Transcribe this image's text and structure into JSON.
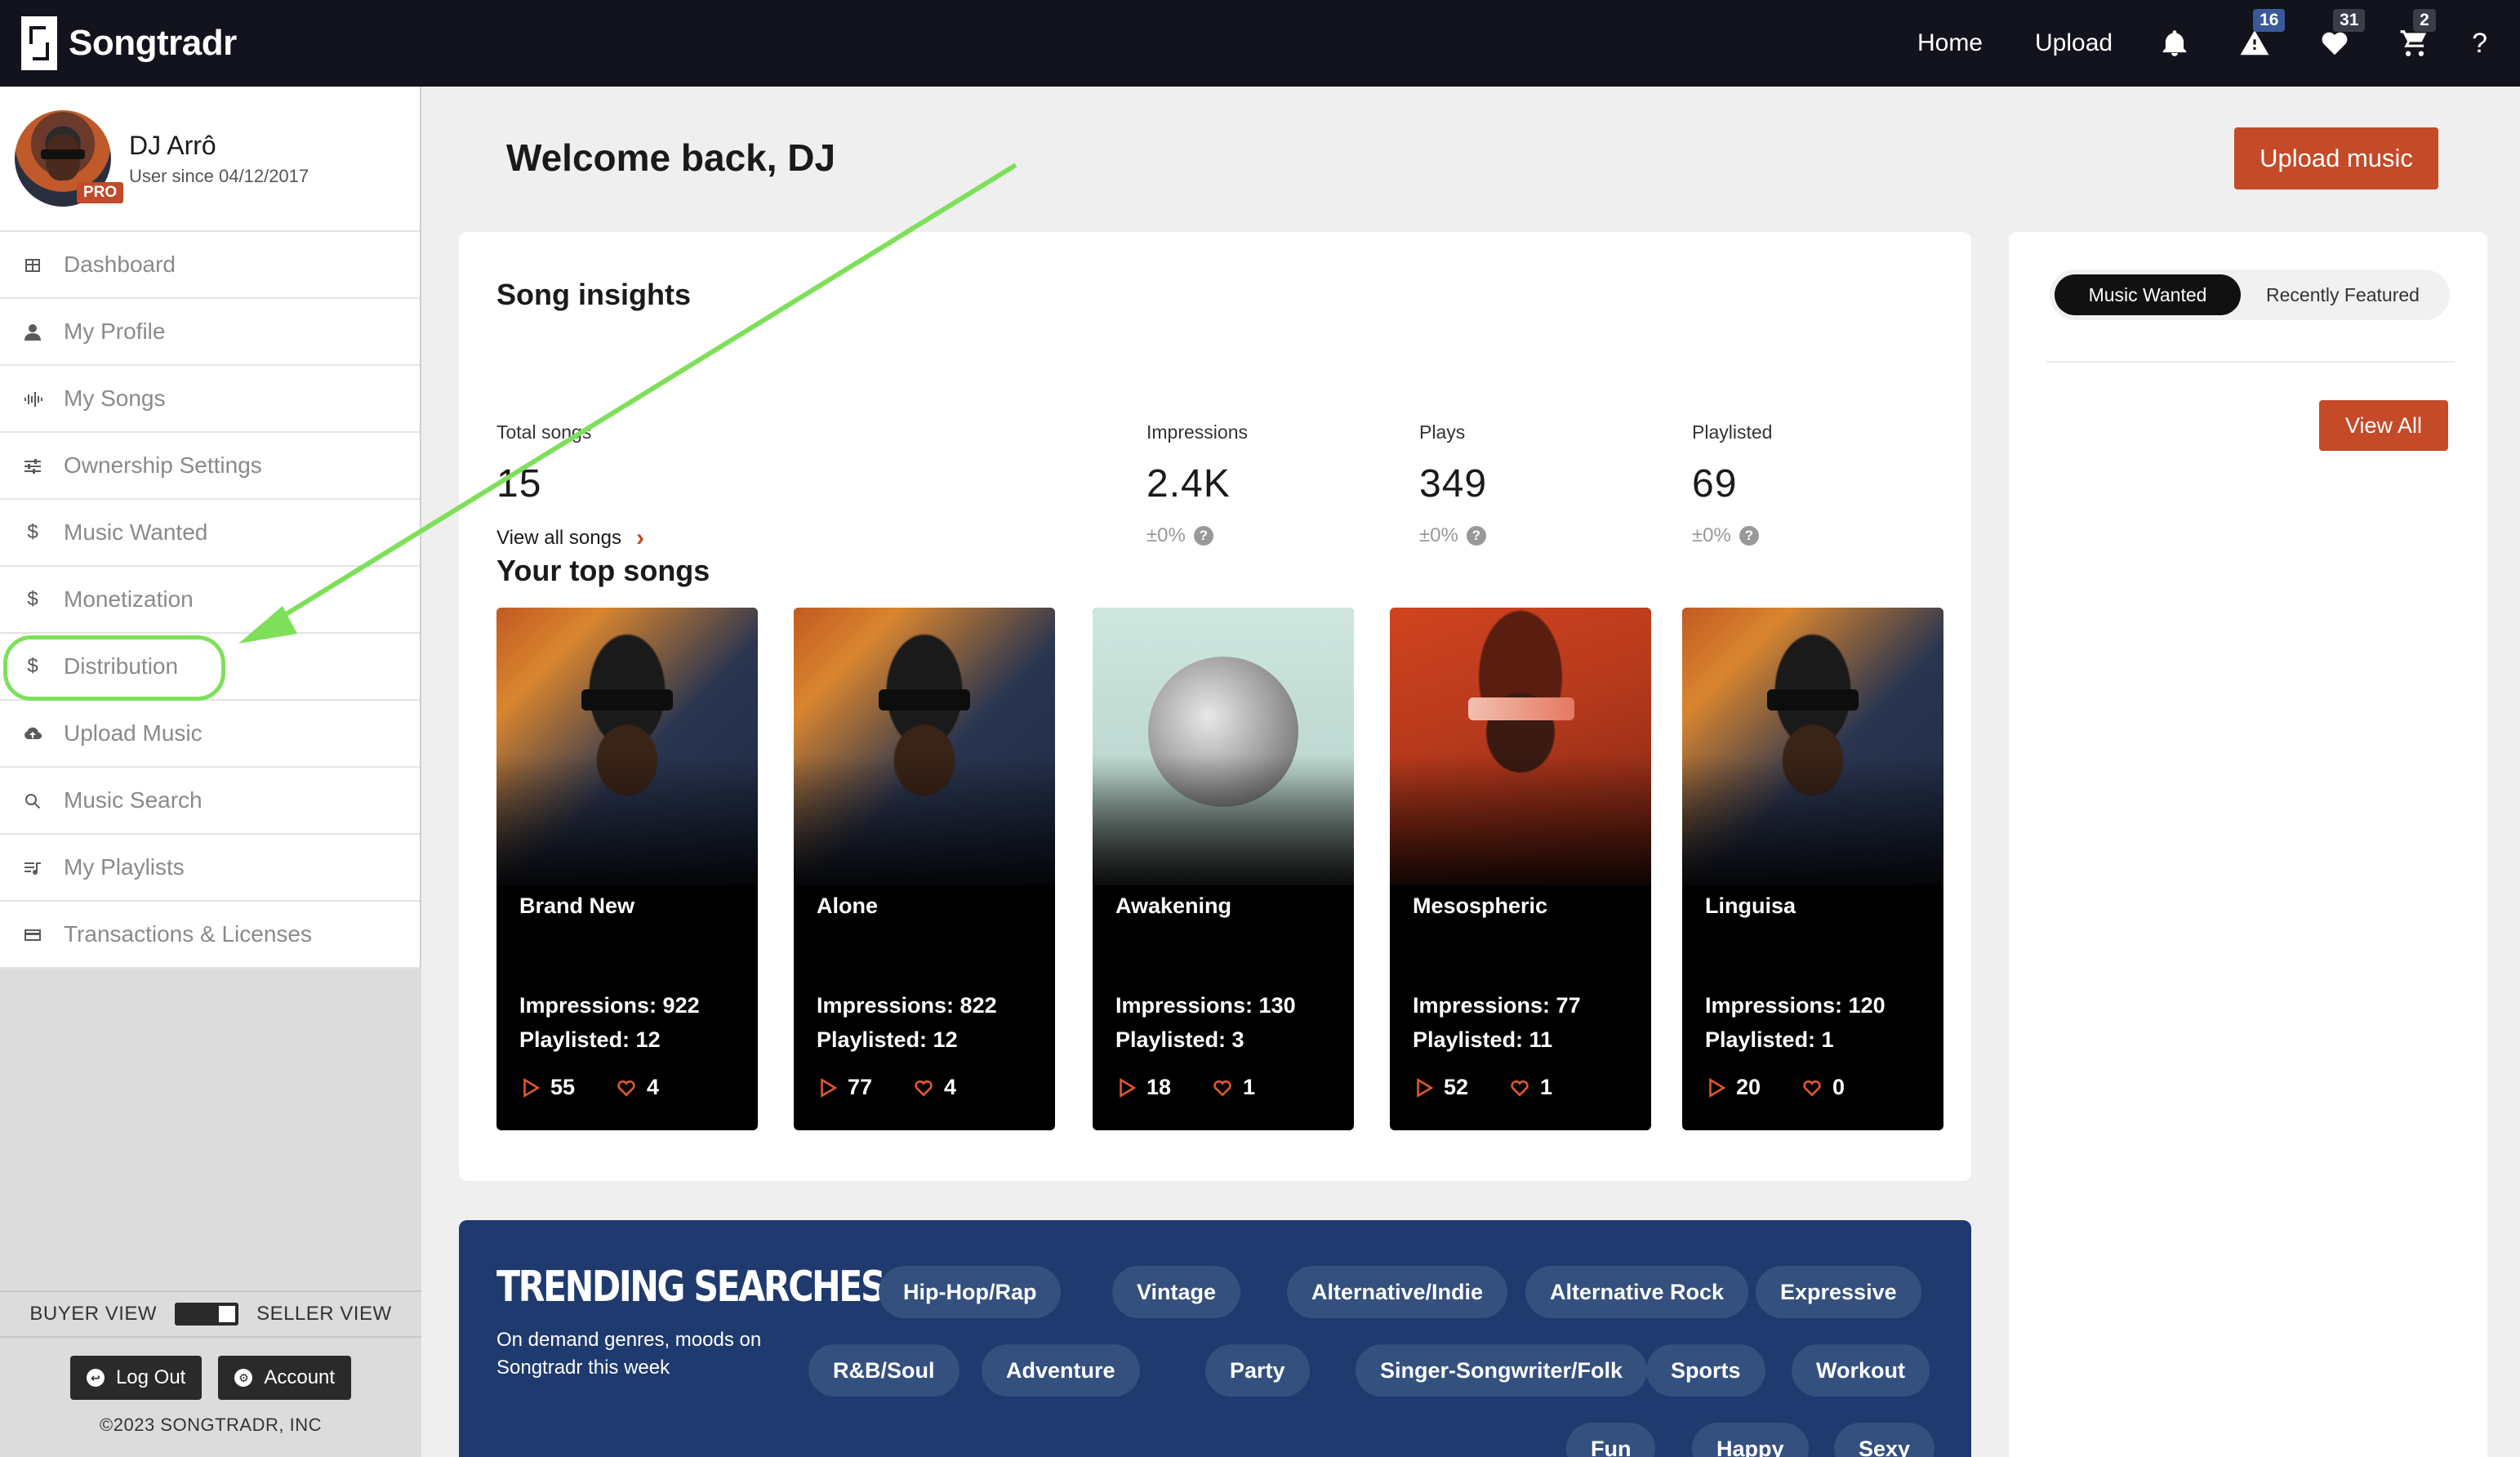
{
  "topbar": {
    "brand": "Songtradr",
    "nav": [
      "Home",
      "Upload"
    ],
    "icons": [
      {
        "name": "bell-icon",
        "badge": ""
      },
      {
        "name": "alert-icon",
        "badge": "16"
      },
      {
        "name": "heart-icon",
        "badge": "31"
      },
      {
        "name": "cart-icon",
        "badge": "2"
      }
    ],
    "help": "?"
  },
  "sidebar": {
    "profile": {
      "name": "DJ Arrô",
      "since": "User since 04/12/2017",
      "badge": "PRO"
    },
    "items": [
      {
        "label": "Dashboard",
        "icon": "dashboard-icon"
      },
      {
        "label": "My Profile",
        "icon": "user-icon"
      },
      {
        "label": "My Songs",
        "icon": "waveform-icon"
      },
      {
        "label": "Ownership Settings",
        "icon": "sliders-icon"
      },
      {
        "label": "Music Wanted",
        "icon": "dollar-icon"
      },
      {
        "label": "Monetization",
        "icon": "dollar-icon"
      },
      {
        "label": "Distribution",
        "icon": "dollar-icon"
      },
      {
        "label": "Upload Music",
        "icon": "cloud-upload-icon"
      },
      {
        "label": "Music Search",
        "icon": "search-icon"
      },
      {
        "label": "My Playlists",
        "icon": "playlist-icon"
      },
      {
        "label": "Transactions & Licenses",
        "icon": "card-icon"
      }
    ],
    "buyer_view": "BUYER VIEW",
    "seller_view": "SELLER VIEW",
    "logout": "Log Out",
    "account": "Account",
    "copyright": "©2023 SONGTRADR, INC"
  },
  "main": {
    "welcome": "Welcome back, DJ",
    "upload_button": "Upload music",
    "insights": {
      "title": "Song insights",
      "total_label": "Total songs",
      "total_value": "15",
      "view_all": "View all songs",
      "stats": [
        {
          "label": "Impressions",
          "value": "2.4K",
          "change": "±0%"
        },
        {
          "label": "Plays",
          "value": "349",
          "change": "±0%"
        },
        {
          "label": "Playlisted",
          "value": "69",
          "change": "±0%"
        }
      ]
    },
    "top_songs_title": "Your top songs",
    "songs": [
      {
        "title": "Brand New",
        "impressions": "Impressions: 922",
        "playlisted": "Playlisted: 12",
        "plays": "55",
        "likes": "4"
      },
      {
        "title": "Alone",
        "impressions": "Impressions: 822",
        "playlisted": "Playlisted: 12",
        "plays": "77",
        "likes": "4"
      },
      {
        "title": "Awakening",
        "impressions": "Impressions: 130",
        "playlisted": "Playlisted: 3",
        "plays": "18",
        "likes": "1"
      },
      {
        "title": "Mesospheric",
        "impressions": "Impressions: 77",
        "playlisted": "Playlisted: 11",
        "plays": "52",
        "likes": "1"
      },
      {
        "title": "Linguisa",
        "impressions": "Impressions: 120",
        "playlisted": "Playlisted: 1",
        "plays": "20",
        "likes": "0"
      }
    ],
    "trending": {
      "title": "TRENDING SEARCHES",
      "subtitle": "On demand genres, moods on Songtradr this week",
      "tags": [
        "Hip-Hop/Rap",
        "Vintage",
        "Alternative/Indie",
        "Alternative Rock",
        "Expressive",
        "R&B/Soul",
        "Adventure",
        "Party",
        "Singer-Songwriter/Folk",
        "Sports",
        "Workout",
        "Fun",
        "Happy",
        "Sexy"
      ]
    }
  },
  "right_panel": {
    "tab_active": "Music Wanted",
    "tab_inactive": "Recently Featured",
    "view_all": "View All"
  },
  "colors": {
    "accent": "#c44a28",
    "topbar": "#12131c",
    "trending_bg": "#1f3a6e",
    "annotation": "#7ee05a"
  }
}
